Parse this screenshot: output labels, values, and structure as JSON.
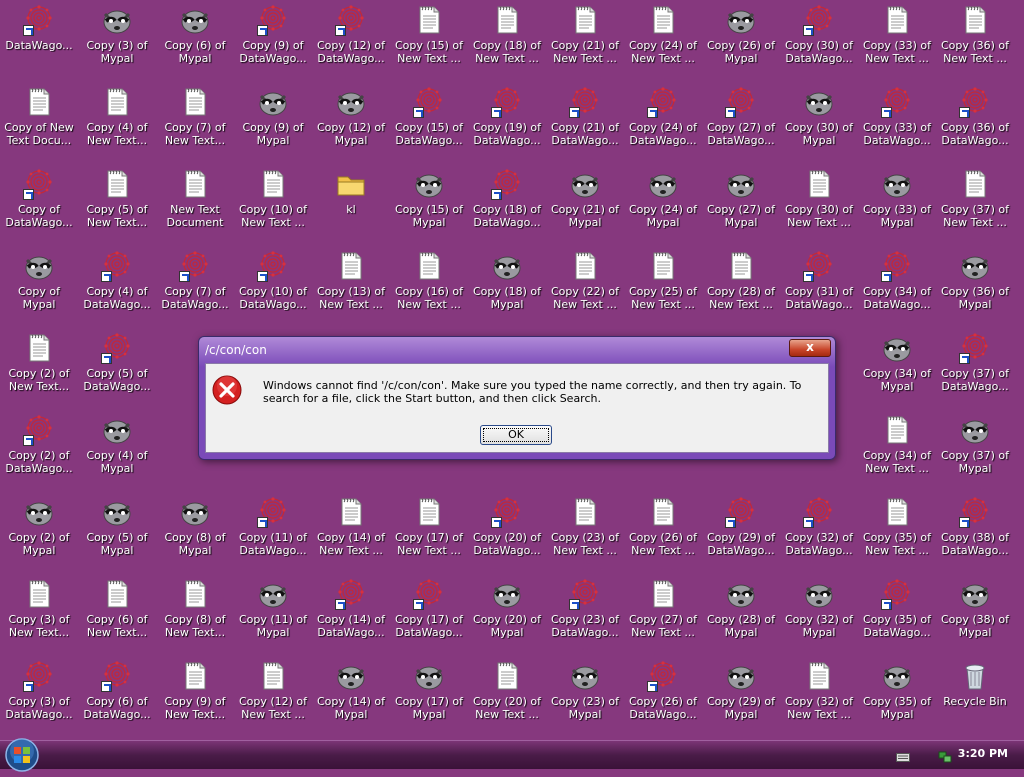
{
  "desktop": {
    "background_color": "#86387e",
    "icons": [
      {
        "label": "DataWago...",
        "type": "datawagon",
        "shortcut": true,
        "col": 0,
        "row": 0
      },
      {
        "label": "Copy (3) of Mypal",
        "type": "mypal",
        "shortcut": false,
        "col": 1,
        "row": 0
      },
      {
        "label": "Copy (6) of Mypal",
        "type": "mypal",
        "shortcut": false,
        "col": 2,
        "row": 0
      },
      {
        "label": "Copy (9) of DataWago...",
        "type": "datawagon",
        "shortcut": true,
        "col": 3,
        "row": 0
      },
      {
        "label": "Copy (12) of DataWago...",
        "type": "datawagon",
        "shortcut": true,
        "col": 4,
        "row": 0
      },
      {
        "label": "Copy (15) of New Text ...",
        "type": "text",
        "shortcut": false,
        "col": 5,
        "row": 0
      },
      {
        "label": "Copy (18) of New Text ...",
        "type": "text",
        "shortcut": false,
        "col": 6,
        "row": 0
      },
      {
        "label": "Copy (21) of New Text ...",
        "type": "text",
        "shortcut": false,
        "col": 7,
        "row": 0
      },
      {
        "label": "Copy (24) of New Text ...",
        "type": "text",
        "shortcut": false,
        "col": 8,
        "row": 0
      },
      {
        "label": "Copy (26) of Mypal",
        "type": "mypal",
        "shortcut": false,
        "col": 9,
        "row": 0
      },
      {
        "label": "Copy (30) of DataWago...",
        "type": "datawagon",
        "shortcut": true,
        "col": 10,
        "row": 0
      },
      {
        "label": "Copy (33) of New Text ...",
        "type": "text",
        "shortcut": false,
        "col": 11,
        "row": 0
      },
      {
        "label": "Copy (36) of New Text ...",
        "type": "text",
        "shortcut": false,
        "col": 12,
        "row": 0
      },
      {
        "label": "Copy of New Text Docu...",
        "type": "text",
        "shortcut": false,
        "col": 0,
        "row": 1
      },
      {
        "label": "Copy (4) of New Text...",
        "type": "text",
        "shortcut": false,
        "col": 1,
        "row": 1
      },
      {
        "label": "Copy (7) of New Text...",
        "type": "text",
        "shortcut": false,
        "col": 2,
        "row": 1
      },
      {
        "label": "Copy (9) of Mypal",
        "type": "mypal",
        "shortcut": false,
        "col": 3,
        "row": 1
      },
      {
        "label": "Copy (12) of Mypal",
        "type": "mypal",
        "shortcut": false,
        "col": 4,
        "row": 1
      },
      {
        "label": "Copy (15) of DataWago...",
        "type": "datawagon",
        "shortcut": true,
        "col": 5,
        "row": 1
      },
      {
        "label": "Copy (19) of DataWago...",
        "type": "datawagon",
        "shortcut": true,
        "col": 6,
        "row": 1
      },
      {
        "label": "Copy (21) of DataWago...",
        "type": "datawagon",
        "shortcut": true,
        "col": 7,
        "row": 1
      },
      {
        "label": "Copy (24) of DataWago...",
        "type": "datawagon",
        "shortcut": true,
        "col": 8,
        "row": 1
      },
      {
        "label": "Copy (27) of DataWago...",
        "type": "datawagon",
        "shortcut": true,
        "col": 9,
        "row": 1
      },
      {
        "label": "Copy (30) of Mypal",
        "type": "mypal",
        "shortcut": false,
        "col": 10,
        "row": 1
      },
      {
        "label": "Copy (33) of DataWago...",
        "type": "datawagon",
        "shortcut": true,
        "col": 11,
        "row": 1
      },
      {
        "label": "Copy (36) of DataWago...",
        "type": "datawagon",
        "shortcut": true,
        "col": 12,
        "row": 1
      },
      {
        "label": "Copy of DataWago...",
        "type": "datawagon",
        "shortcut": true,
        "col": 0,
        "row": 2
      },
      {
        "label": "Copy (5) of New Text...",
        "type": "text",
        "shortcut": false,
        "col": 1,
        "row": 2
      },
      {
        "label": "New Text Document",
        "type": "text",
        "shortcut": false,
        "col": 2,
        "row": 2
      },
      {
        "label": "Copy (10) of New Text ...",
        "type": "text",
        "shortcut": false,
        "col": 3,
        "row": 2
      },
      {
        "label": "kl",
        "type": "folder",
        "shortcut": false,
        "col": 4,
        "row": 2
      },
      {
        "label": "Copy (15) of Mypal",
        "type": "mypal",
        "shortcut": false,
        "col": 5,
        "row": 2
      },
      {
        "label": "Copy (18) of DataWago...",
        "type": "datawagon",
        "shortcut": true,
        "col": 6,
        "row": 2
      },
      {
        "label": "Copy (21) of Mypal",
        "type": "mypal",
        "shortcut": false,
        "col": 7,
        "row": 2
      },
      {
        "label": "Copy (24) of Mypal",
        "type": "mypal",
        "shortcut": false,
        "col": 8,
        "row": 2
      },
      {
        "label": "Copy (27) of Mypal",
        "type": "mypal",
        "shortcut": false,
        "col": 9,
        "row": 2
      },
      {
        "label": "Copy (30) of New Text ...",
        "type": "text",
        "shortcut": false,
        "col": 10,
        "row": 2
      },
      {
        "label": "Copy (33) of Mypal",
        "type": "mypal",
        "shortcut": false,
        "col": 11,
        "row": 2
      },
      {
        "label": "Copy (37) of New Text ...",
        "type": "text",
        "shortcut": false,
        "col": 12,
        "row": 2
      },
      {
        "label": "Copy of Mypal",
        "type": "mypal",
        "shortcut": false,
        "col": 0,
        "row": 3
      },
      {
        "label": "Copy (4) of DataWago...",
        "type": "datawagon",
        "shortcut": true,
        "col": 1,
        "row": 3
      },
      {
        "label": "Copy (7) of DataWago...",
        "type": "datawagon",
        "shortcut": true,
        "col": 2,
        "row": 3
      },
      {
        "label": "Copy (10) of DataWago...",
        "type": "datawagon",
        "shortcut": true,
        "col": 3,
        "row": 3
      },
      {
        "label": "Copy (13) of New Text ...",
        "type": "text",
        "shortcut": false,
        "col": 4,
        "row": 3
      },
      {
        "label": "Copy (16) of New Text ...",
        "type": "text",
        "shortcut": false,
        "col": 5,
        "row": 3
      },
      {
        "label": "Copy (18) of Mypal",
        "type": "mypal",
        "shortcut": false,
        "col": 6,
        "row": 3
      },
      {
        "label": "Copy (22) of New Text ...",
        "type": "text",
        "shortcut": false,
        "col": 7,
        "row": 3
      },
      {
        "label": "Copy (25) of New Text ...",
        "type": "text",
        "shortcut": false,
        "col": 8,
        "row": 3
      },
      {
        "label": "Copy (28) of New Text ...",
        "type": "text",
        "shortcut": false,
        "col": 9,
        "row": 3
      },
      {
        "label": "Copy (31) of DataWago...",
        "type": "datawagon",
        "shortcut": true,
        "col": 10,
        "row": 3
      },
      {
        "label": "Copy (34) of DataWago...",
        "type": "datawagon",
        "shortcut": true,
        "col": 11,
        "row": 3
      },
      {
        "label": "Copy (36) of Mypal",
        "type": "mypal",
        "shortcut": false,
        "col": 12,
        "row": 3
      },
      {
        "label": "Copy (2) of New Text...",
        "type": "text",
        "shortcut": false,
        "col": 0,
        "row": 4
      },
      {
        "label": "Copy (5) of DataWago...",
        "type": "datawagon",
        "shortcut": true,
        "col": 1,
        "row": 4
      },
      {
        "label": "Copy (34) of Mypal",
        "type": "mypal",
        "shortcut": false,
        "col": 11,
        "row": 4
      },
      {
        "label": "Copy (37) of DataWago...",
        "type": "datawagon",
        "shortcut": true,
        "col": 12,
        "row": 4
      },
      {
        "label": "Copy (2) of DataWago...",
        "type": "datawagon",
        "shortcut": true,
        "col": 0,
        "row": 5
      },
      {
        "label": "Copy (4) of Mypal",
        "type": "mypal",
        "shortcut": false,
        "col": 1,
        "row": 5
      },
      {
        "label": "Copy (34) of New Text ...",
        "type": "text",
        "shortcut": false,
        "col": 11,
        "row": 5
      },
      {
        "label": "Copy (37) of Mypal",
        "type": "mypal",
        "shortcut": false,
        "col": 12,
        "row": 5
      },
      {
        "label": "Copy (2) of Mypal",
        "type": "mypal",
        "shortcut": false,
        "col": 0,
        "row": 6
      },
      {
        "label": "Copy (5) of Mypal",
        "type": "mypal",
        "shortcut": false,
        "col": 1,
        "row": 6
      },
      {
        "label": "Copy (8) of Mypal",
        "type": "mypal",
        "shortcut": false,
        "col": 2,
        "row": 6
      },
      {
        "label": "Copy (11) of DataWago...",
        "type": "datawagon",
        "shortcut": true,
        "col": 3,
        "row": 6
      },
      {
        "label": "Copy (14) of New Text ...",
        "type": "text",
        "shortcut": false,
        "col": 4,
        "row": 6
      },
      {
        "label": "Copy (17) of New Text ...",
        "type": "text",
        "shortcut": false,
        "col": 5,
        "row": 6
      },
      {
        "label": "Copy (20) of DataWago...",
        "type": "datawagon",
        "shortcut": true,
        "col": 6,
        "row": 6
      },
      {
        "label": "Copy (23) of New Text ...",
        "type": "text",
        "shortcut": false,
        "col": 7,
        "row": 6
      },
      {
        "label": "Copy (26) of New Text ...",
        "type": "text",
        "shortcut": false,
        "col": 8,
        "row": 6
      },
      {
        "label": "Copy (29) of DataWago...",
        "type": "datawagon",
        "shortcut": true,
        "col": 9,
        "row": 6
      },
      {
        "label": "Copy (32) of DataWago...",
        "type": "datawagon",
        "shortcut": true,
        "col": 10,
        "row": 6
      },
      {
        "label": "Copy (35) of New Text ...",
        "type": "text",
        "shortcut": false,
        "col": 11,
        "row": 6
      },
      {
        "label": "Copy (38) of DataWago...",
        "type": "datawagon",
        "shortcut": true,
        "col": 12,
        "row": 6
      },
      {
        "label": "Copy (3) of New Text...",
        "type": "text",
        "shortcut": false,
        "col": 0,
        "row": 7
      },
      {
        "label": "Copy (6) of New Text...",
        "type": "text",
        "shortcut": false,
        "col": 1,
        "row": 7
      },
      {
        "label": "Copy (8) of New Text...",
        "type": "text",
        "shortcut": false,
        "col": 2,
        "row": 7
      },
      {
        "label": "Copy (11) of Mypal",
        "type": "mypal",
        "shortcut": false,
        "col": 3,
        "row": 7
      },
      {
        "label": "Copy (14) of DataWago...",
        "type": "datawagon",
        "shortcut": true,
        "col": 4,
        "row": 7
      },
      {
        "label": "Copy (17) of DataWago...",
        "type": "datawagon",
        "shortcut": true,
        "col": 5,
        "row": 7
      },
      {
        "label": "Copy (20) of Mypal",
        "type": "mypal",
        "shortcut": false,
        "col": 6,
        "row": 7
      },
      {
        "label": "Copy (23) of DataWago...",
        "type": "datawagon",
        "shortcut": true,
        "col": 7,
        "row": 7
      },
      {
        "label": "Copy (27) of New Text ...",
        "type": "text",
        "shortcut": false,
        "col": 8,
        "row": 7
      },
      {
        "label": "Copy (28) of Mypal",
        "type": "mypal",
        "shortcut": false,
        "col": 9,
        "row": 7
      },
      {
        "label": "Copy (32) of Mypal",
        "type": "mypal",
        "shortcut": false,
        "col": 10,
        "row": 7
      },
      {
        "label": "Copy (35) of DataWago...",
        "type": "datawagon",
        "shortcut": true,
        "col": 11,
        "row": 7
      },
      {
        "label": "Copy (38) of Mypal",
        "type": "mypal",
        "shortcut": false,
        "col": 12,
        "row": 7
      },
      {
        "label": "Copy (3) of DataWago...",
        "type": "datawagon",
        "shortcut": true,
        "col": 0,
        "row": 8
      },
      {
        "label": "Copy (6) of DataWago...",
        "type": "datawagon",
        "shortcut": true,
        "col": 1,
        "row": 8
      },
      {
        "label": "Copy (9) of New Text...",
        "type": "text",
        "shortcut": false,
        "col": 2,
        "row": 8
      },
      {
        "label": "Copy (12) of New Text ...",
        "type": "text",
        "shortcut": false,
        "col": 3,
        "row": 8
      },
      {
        "label": "Copy (14) of Mypal",
        "type": "mypal",
        "shortcut": false,
        "col": 4,
        "row": 8
      },
      {
        "label": "Copy (17) of Mypal",
        "type": "mypal",
        "shortcut": false,
        "col": 5,
        "row": 8
      },
      {
        "label": "Copy (20) of New Text ...",
        "type": "text",
        "shortcut": false,
        "col": 6,
        "row": 8
      },
      {
        "label": "Copy (23) of Mypal",
        "type": "mypal",
        "shortcut": false,
        "col": 7,
        "row": 8
      },
      {
        "label": "Copy (26) of DataWago...",
        "type": "datawagon",
        "shortcut": true,
        "col": 8,
        "row": 8
      },
      {
        "label": "Copy (29) of Mypal",
        "type": "mypal",
        "shortcut": false,
        "col": 9,
        "row": 8
      },
      {
        "label": "Copy (32) of New Text ...",
        "type": "text",
        "shortcut": false,
        "col": 10,
        "row": 8
      },
      {
        "label": "Copy (35) of Mypal",
        "type": "mypal",
        "shortcut": false,
        "col": 11,
        "row": 8
      },
      {
        "label": "Recycle Bin",
        "type": "recycle",
        "shortcut": false,
        "col": 12,
        "row": 8
      }
    ]
  },
  "dialog": {
    "title": "/c/con/con",
    "close_label": "x",
    "message": "Windows cannot find '/c/con/con'. Make sure you typed the name correctly, and then try again. To search for a file, click the Start button, and then click Search.",
    "ok_label": "OK",
    "icon": "error-icon"
  },
  "taskbar": {
    "start_icon": "windows-logo-icon",
    "clock": "3:20 PM",
    "tray_icons": [
      "keyboard-icon",
      "network-icon"
    ]
  }
}
